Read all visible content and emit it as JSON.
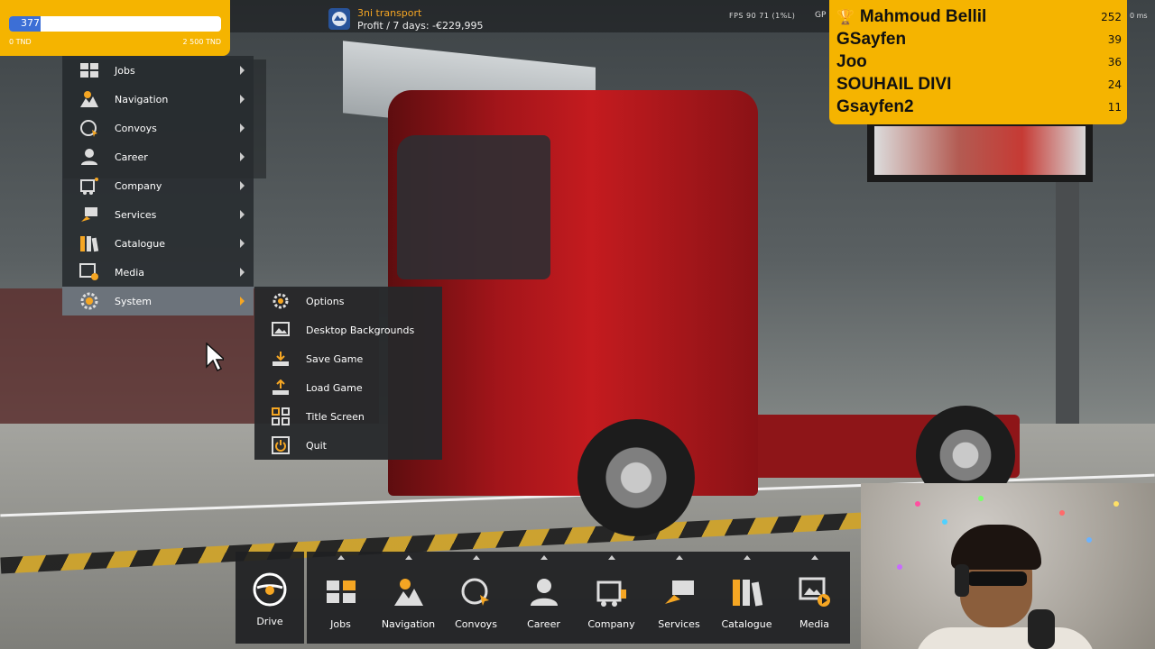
{
  "donation_goal": {
    "current": "377",
    "min": "0 TND",
    "max": "2 500 TND",
    "progress_fraction": 0.15
  },
  "hud": {
    "company_name": "3ni transport",
    "profit": "Profit / 7 days: -€229,995",
    "fps_text": "FPS  90   71 (1%L)",
    "gp_text": "GP",
    "ms_text": "0 ms"
  },
  "leaderboard": [
    {
      "name": "Mahmoud Bellil",
      "score": "252"
    },
    {
      "name": "GSayfen",
      "score": "39"
    },
    {
      "name": "Joo",
      "score": "36"
    },
    {
      "name": "SOUHAIL DIVI",
      "score": "24"
    },
    {
      "name": "Gsayfen2",
      "score": "11"
    }
  ],
  "menu": {
    "items": [
      {
        "label": "Jobs",
        "icon": "jobs-icon"
      },
      {
        "label": "Navigation",
        "icon": "navigation-icon"
      },
      {
        "label": "Convoys",
        "icon": "convoys-icon"
      },
      {
        "label": "Career",
        "icon": "career-icon"
      },
      {
        "label": "Company",
        "icon": "company-icon"
      },
      {
        "label": "Services",
        "icon": "services-icon"
      },
      {
        "label": "Catalogue",
        "icon": "catalogue-icon"
      },
      {
        "label": "Media",
        "icon": "media-icon"
      },
      {
        "label": "System",
        "icon": "system-icon",
        "active": true
      }
    ]
  },
  "submenu": {
    "items": [
      {
        "label": "Options",
        "icon": "options-icon"
      },
      {
        "label": "Desktop Backgrounds",
        "icon": "desktop-backgrounds-icon"
      },
      {
        "label": "Save Game",
        "icon": "save-game-icon"
      },
      {
        "label": "Load Game",
        "icon": "load-game-icon"
      },
      {
        "label": "Title Screen",
        "icon": "title-screen-icon"
      },
      {
        "label": "Quit",
        "icon": "quit-icon"
      }
    ]
  },
  "bottom_bar": {
    "drive_label": "Drive",
    "items": [
      {
        "label": "Jobs",
        "icon": "jobs-icon"
      },
      {
        "label": "Navigation",
        "icon": "navigation-icon"
      },
      {
        "label": "Convoys",
        "icon": "convoys-icon"
      },
      {
        "label": "Career",
        "icon": "career-icon"
      },
      {
        "label": "Company",
        "icon": "company-icon"
      },
      {
        "label": "Services",
        "icon": "services-icon"
      },
      {
        "label": "Catalogue",
        "icon": "catalogue-icon"
      },
      {
        "label": "Media",
        "icon": "media-icon"
      }
    ]
  },
  "colors": {
    "accent_yellow": "#f5b400",
    "progress_blue": "#3c6fd6",
    "company_orange": "#f5a623",
    "menu_active": "#6c737b"
  }
}
